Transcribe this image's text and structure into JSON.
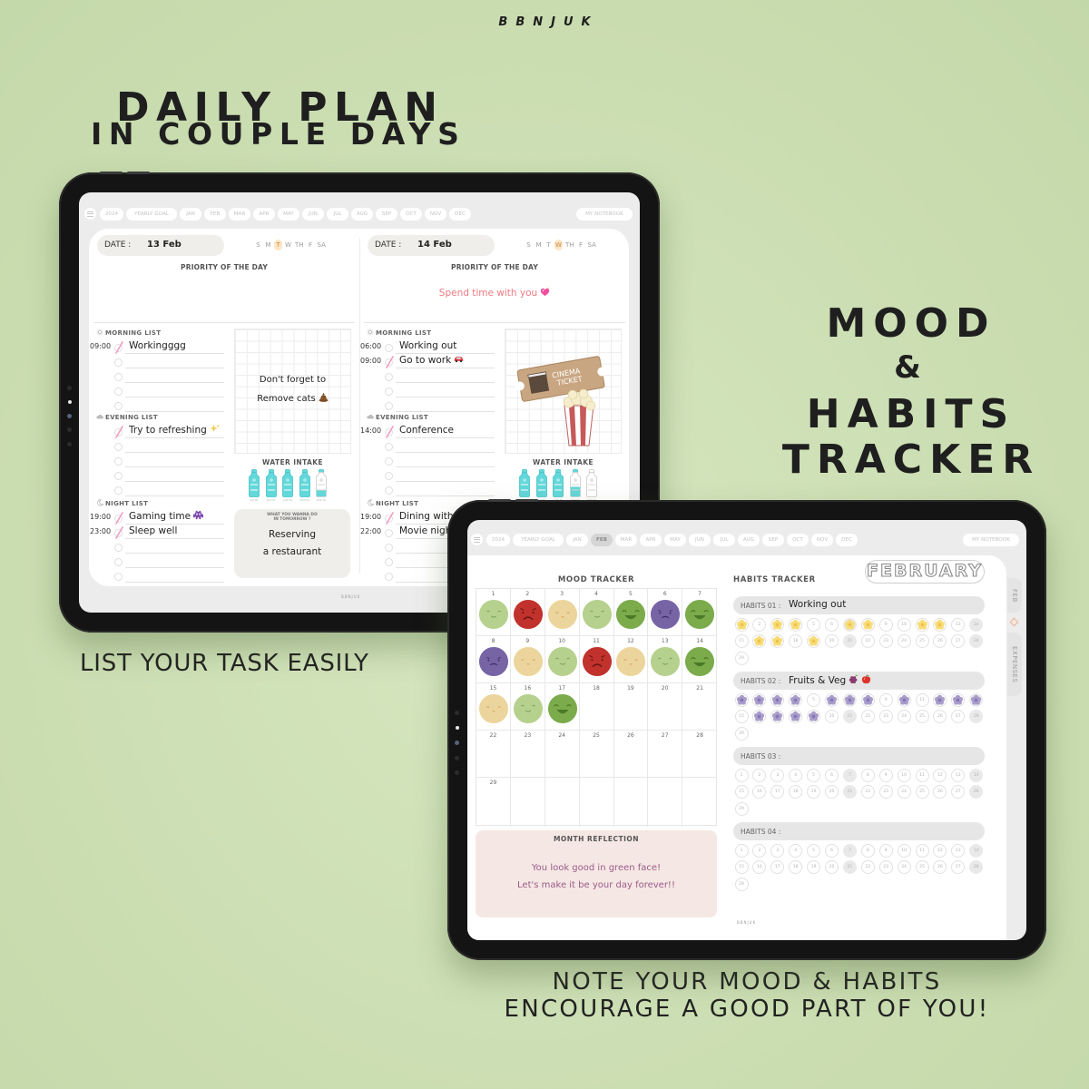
{
  "brand": "BBNJUK",
  "headlines": {
    "daily_plan_1": "DAILY PLAN",
    "daily_plan_2": "IN COUPLE DAYS",
    "mood_1": "MOOD",
    "mood_2": "&",
    "mood_3": "HABITS",
    "mood_4": "TRACKER",
    "list_caption": "LIST YOUR TASK EASILY",
    "note_caption_1": "NOTE YOUR MOOD & HABITS",
    "note_caption_2": "ENCOURAGE A GOOD PART OF YOU!"
  },
  "nav": {
    "year": "2024",
    "yearly_goal": "YEARLY GOAL",
    "months": [
      "JAN",
      "FEB",
      "MAR",
      "APR",
      "MAY",
      "JUN",
      "JUL",
      "AUG",
      "SEP",
      "OCT",
      "NOV",
      "DEC"
    ],
    "notebook": "MY NOTEBOOK"
  },
  "left_tablet": {
    "active_month": null,
    "footer_brand": "BBNJUK"
  },
  "daily_plan": {
    "date_label": "DATE :",
    "priority_label": "PRIORITY OF THE DAY",
    "weekdays": [
      "S",
      "M",
      "T",
      "W",
      "TH",
      "F",
      "SA"
    ],
    "section_labels": {
      "morning": "MORNING LIST",
      "evening": "EVENING LIST",
      "night": "NIGHT LIST"
    },
    "water_label": "WATER INTAKE",
    "water_units": [
      "400 ML",
      "800 ML",
      "1200 ML",
      "1600 ML",
      "2000 ML"
    ],
    "tomorrow_label_1": "WHAT YOU WANNA DO",
    "tomorrow_label_2": "IN TOMORROW ?",
    "pen_color": "#f29bc4",
    "days": [
      {
        "date": "13 Feb",
        "weekday_highlight": "T",
        "priority": "",
        "morning": [
          {
            "time": "09:00",
            "text": "Workingggg",
            "done": true
          },
          {
            "time": "",
            "text": "",
            "done": false
          },
          {
            "time": "",
            "text": "",
            "done": false
          },
          {
            "time": "",
            "text": "",
            "done": false
          },
          {
            "time": "",
            "text": "",
            "done": false
          }
        ],
        "evening": [
          {
            "time": "",
            "text": "Try to refreshing",
            "icon": "sparkle",
            "done": true
          },
          {
            "time": "",
            "text": "",
            "done": false
          },
          {
            "time": "",
            "text": "",
            "done": false
          },
          {
            "time": "",
            "text": "",
            "done": false
          },
          {
            "time": "",
            "text": "",
            "done": false
          }
        ],
        "night": [
          {
            "time": "19:00",
            "text": "Gaming time",
            "icon": "alien-monster",
            "done": true
          },
          {
            "time": "23:00",
            "text": "Sleep well",
            "done": true
          },
          {
            "time": "",
            "text": "",
            "done": false
          },
          {
            "time": "",
            "text": "",
            "done": false
          },
          {
            "time": "",
            "text": "",
            "done": false
          }
        ],
        "note": {
          "line_1": "Don't forget to",
          "line_2": "Remove cats",
          "icon": "poop"
        },
        "water_fill": [
          1,
          1,
          1,
          1,
          0.35
        ],
        "tomorrow": {
          "line_1": "Reserving",
          "line_2": "a restaurant"
        }
      },
      {
        "date": "14 Feb",
        "weekday_highlight": "W",
        "priority": "Spend time with you",
        "priority_icon": "sparkling-heart",
        "morning": [
          {
            "time": "06:00",
            "text": "Working out",
            "done": false
          },
          {
            "time": "09:00",
            "text": "Go to work",
            "icon": "car",
            "done": true
          },
          {
            "time": "",
            "text": "",
            "done": false
          },
          {
            "time": "",
            "text": "",
            "done": false
          },
          {
            "time": "",
            "text": "",
            "done": false
          }
        ],
        "evening": [
          {
            "time": "14:00",
            "text": "Conference",
            "done": true
          },
          {
            "time": "",
            "text": "",
            "done": false
          },
          {
            "time": "",
            "text": "",
            "done": false
          },
          {
            "time": "",
            "text": "",
            "done": false
          },
          {
            "time": "",
            "text": "",
            "done": false
          }
        ],
        "night": [
          {
            "time": "19:00",
            "text": "Dining with",
            "done": true
          },
          {
            "time": "22:00",
            "text": "Movie night",
            "done": false
          },
          {
            "time": "",
            "text": "",
            "done": false
          },
          {
            "time": "",
            "text": "",
            "done": false
          },
          {
            "time": "",
            "text": "",
            "done": false
          }
        ],
        "sticker": {
          "type": "cinema-ticket-popcorn",
          "ticket_text": [
            "CINEMA",
            "TICKET"
          ]
        },
        "water_fill": [
          1,
          1,
          1,
          0.5,
          0
        ]
      }
    ]
  },
  "right_tablet": {
    "active_month": "FEB",
    "footer_brand": "BBNJUK",
    "side_tabs": [
      "FEB",
      "EXPENSES"
    ]
  },
  "monthly_tracker": {
    "month_title": "FEBRUARY",
    "mood_title": "MOOD TRACKER",
    "habits_title": "HABITS TRACKER",
    "day_numbers": [
      "1",
      "2",
      "3",
      "4",
      "5",
      "6",
      "7",
      "8",
      "9",
      "10",
      "11",
      "12",
      "13",
      "14",
      "15",
      "16",
      "17",
      "18",
      "19",
      "20",
      "21",
      "22",
      "23",
      "24",
      "25",
      "26",
      "27",
      "28",
      "29"
    ],
    "moods": {
      "calm": {
        "color": "#b6d18e",
        "feature_color": "#7ea35a"
      },
      "upset": {
        "color": "#c1322d",
        "feature_color": "#6a1512"
      },
      "neutral": {
        "color": "#ecd59c",
        "feature_color": "#d59d55"
      },
      "joyful": {
        "color": "#7bab4b",
        "feature_color": "#4b7a26"
      },
      "sad": {
        "color": "#7764a5",
        "feature_color": "#3d2e6d"
      }
    },
    "mood_by_day": [
      "calm",
      "upset",
      "neutral",
      "calm",
      "joyful",
      "sad",
      "joyful",
      "sad",
      "neutral",
      "calm",
      "upset",
      "neutral",
      "calm",
      "joyful",
      "neutral",
      "calm",
      "joyful",
      null,
      null,
      null,
      null,
      null,
      null,
      null,
      null,
      null,
      null,
      null,
      null
    ],
    "reflection_title": "MONTH REFLECTION",
    "reflection_line_1": "You look good in green face!",
    "reflection_line_2": "Let's make it be your day forever!!",
    "shaded_days": [
      7,
      14,
      21,
      28
    ],
    "markers": {
      "yellow-flower": {
        "petal": "#f8dc78",
        "center": "#ebc44f"
      },
      "purple-flower": {
        "petal": "#a99dcb",
        "center": "#8576b4"
      }
    },
    "habits": [
      {
        "label": "HABITS 01 :",
        "name": "Working out",
        "icons": [],
        "marker": "yellow-flower",
        "done_days": [
          1,
          3,
          4,
          7,
          8,
          11,
          12,
          16,
          17,
          19
        ]
      },
      {
        "label": "HABITS 02 :",
        "name": "Fruits & Veg",
        "icons": [
          "grapes",
          "apple"
        ],
        "marker": "purple-flower",
        "done_days": [
          1,
          2,
          3,
          4,
          6,
          7,
          8,
          10,
          12,
          13,
          14,
          16,
          17,
          18,
          19
        ]
      },
      {
        "label": "HABITS 03 :",
        "name": "",
        "icons": [],
        "marker": null,
        "done_days": []
      },
      {
        "label": "HABITS 04 :",
        "name": "",
        "icons": [],
        "marker": null,
        "done_days": []
      }
    ]
  }
}
